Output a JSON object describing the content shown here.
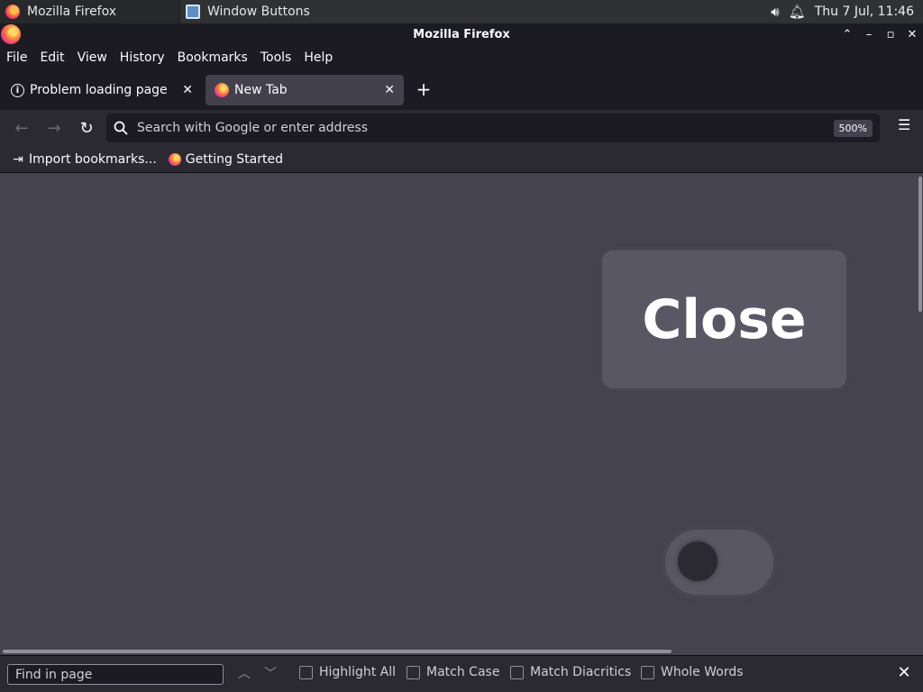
{
  "taskbar": {
    "items": [
      {
        "label": "Mozilla Firefox",
        "icon": "firefox-icon",
        "active": true
      },
      {
        "label": "Window Buttons",
        "icon": "window-buttons-icon",
        "active": false
      }
    ],
    "tray": {
      "volume_icon": "volume-icon",
      "bell_icon": "notification-bell-icon",
      "clock": "Thu  7 Jul, 11:46"
    }
  },
  "window": {
    "title": "Mozilla Firefox",
    "controls": [
      "chevron-up-icon",
      "minimize-icon",
      "maximize-icon",
      "close-icon"
    ]
  },
  "menubar": {
    "items": [
      "File",
      "Edit",
      "View",
      "History",
      "Bookmarks",
      "Tools",
      "Help"
    ]
  },
  "tabs": [
    {
      "label": "Problem loading page",
      "icon": "info-icon",
      "selected": false
    },
    {
      "label": "New Tab",
      "icon": "firefox-icon",
      "selected": true
    }
  ],
  "navbar": {
    "search_placeholder": "Search with Google or enter address",
    "zoom": "500%"
  },
  "bookmarks": [
    {
      "label": "Import bookmarks...",
      "icon": "import-icon"
    },
    {
      "label": "Getting Started",
      "icon": "firefox-icon"
    }
  ],
  "content": {
    "close_button_label": "Close",
    "toggle_state": "off"
  },
  "findbar": {
    "placeholder": "Find in page",
    "options": [
      "Highlight All",
      "Match Case",
      "Match Diacritics",
      "Whole Words"
    ]
  },
  "colors": {
    "content_bg": "#45434f",
    "toolbar_bg": "#2b2a33",
    "tabstrip_bg": "#1c1b22"
  }
}
